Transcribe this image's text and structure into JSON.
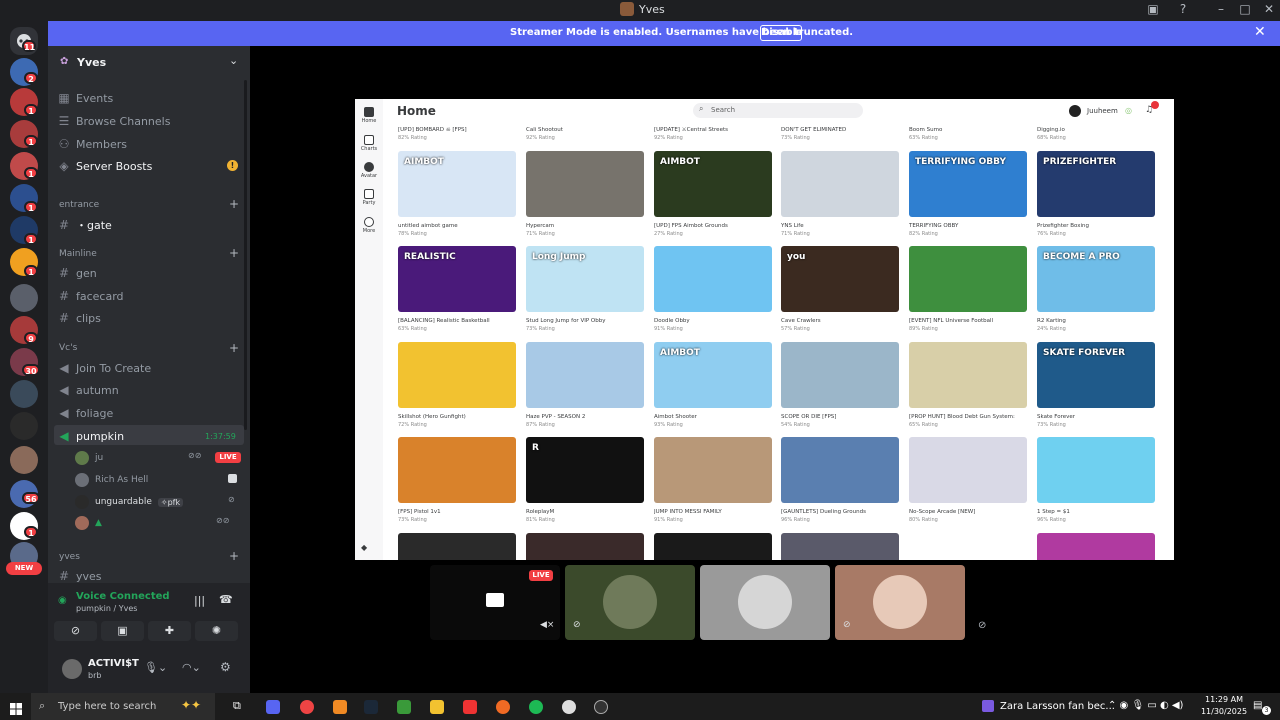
{
  "window": {
    "title": "Yves"
  },
  "banner": {
    "text": "Streamer Mode is enabled. Usernames have been truncated.",
    "disable_label": "Disable"
  },
  "rail": {
    "badges": [
      "11",
      "2",
      "1",
      "1",
      "1",
      "1",
      "1",
      "1",
      "1",
      "9",
      "30",
      "56",
      "1"
    ],
    "new_label": "NEW"
  },
  "server": {
    "name": "Yves"
  },
  "sidebar": {
    "top_items": [
      "Events",
      "Browse Channels",
      "Members",
      "Server Boosts"
    ],
    "categories": {
      "entrance": "entrance",
      "mainline": "Mainline",
      "vcs": "Vc's",
      "yves": "yves"
    },
    "channels": {
      "gate": "・gate",
      "gen": "gen",
      "facecard": "facecard",
      "clips": "clips",
      "join": "Join To Create",
      "autumn": "autumn",
      "foliage": "foliage",
      "pumpkin": "pumpkin",
      "pumpkin_time": "1:37:59",
      "yves": "yves"
    },
    "voice_users": [
      "ju",
      "Rich As Hell",
      "unguardable",
      "✧pfk",
      ""
    ],
    "live_label": "LIVE"
  },
  "voice": {
    "status": "Voice Connected",
    "channel": "pumpkin / Yves"
  },
  "user": {
    "name": "ACTIVI$T",
    "status": "brb"
  },
  "roblox": {
    "page_title": "Home",
    "search_placeholder": "Search",
    "username": "Juuheem",
    "nav": [
      "Home",
      "Charts",
      "Avatar",
      "Party",
      "More"
    ],
    "top_row": [
      {
        "name": "[UPD] BOMBARD ☠ [FPS]",
        "rating": "82% Rating"
      },
      {
        "name": "Cali Shootout",
        "rating": "92% Rating"
      },
      {
        "name": "[UPDATE] ⚔Central Streets",
        "rating": "92% Rating"
      },
      {
        "name": "DON'T GET ELIMINATED",
        "rating": "73% Rating"
      },
      {
        "name": "Boom Sumo",
        "rating": "63% Rating"
      },
      {
        "name": "Digging.io",
        "rating": "68% Rating"
      }
    ],
    "rows": [
      [
        {
          "name": "untitled aimbot game",
          "rating": "78% Rating",
          "color": "#d8e6f5",
          "label": "AIMBOT"
        },
        {
          "name": "Hypercam",
          "rating": "71% Rating",
          "color": "#77736c",
          "label": ""
        },
        {
          "name": "[UPD] FPS Aimbot Grounds",
          "rating": "27% Rating",
          "color": "#2b3b1f",
          "label": "AIMBOT"
        },
        {
          "name": "YNS Life",
          "rating": "71% Rating",
          "color": "#cfd6de",
          "label": ""
        },
        {
          "name": "TERRIFYING OBBY",
          "rating": "82% Rating",
          "color": "#2f7fd0",
          "label": "TERRIFYING OBBY"
        },
        {
          "name": "Prizefighter Boxing",
          "rating": "76% Rating",
          "color": "#243b6e",
          "label": "PRIZEFIGHTER"
        }
      ],
      [
        {
          "name": "[BALANCING] Realistic Basketball",
          "rating": "63% Rating",
          "color": "#4a1a7a",
          "label": "REALISTIC"
        },
        {
          "name": "Stud Long Jump for VIP Obby",
          "rating": "73% Rating",
          "color": "#bfe3f3",
          "label": "Long Jump"
        },
        {
          "name": "Doodle Obby",
          "rating": "91% Rating",
          "color": "#6fc4f2",
          "label": ""
        },
        {
          "name": "Cave Crawlers",
          "rating": "57% Rating",
          "color": "#3b2a20",
          "label": "you"
        },
        {
          "name": "[EVENT] NFL Universe Football",
          "rating": "89% Rating",
          "color": "#3e8f3e",
          "label": ""
        },
        {
          "name": "R2 Karting",
          "rating": "24% Rating",
          "color": "#6fbde8",
          "label": "BECOME A PRO"
        }
      ],
      [
        {
          "name": "Skillshot (Hero Gunfight)",
          "rating": "72% Rating",
          "color": "#f2c230",
          "label": ""
        },
        {
          "name": "Haze PVP - SEASON 2",
          "rating": "87% Rating",
          "color": "#a8c9e6",
          "label": ""
        },
        {
          "name": "Aimbot Shooter",
          "rating": "93% Rating",
          "color": "#8fcdf0",
          "label": "AIMBOT"
        },
        {
          "name": "SCOPE OR DIE [FPS]",
          "rating": "54% Rating",
          "color": "#9bb6c9",
          "label": ""
        },
        {
          "name": "[PROP HUNT] Blood Debt Gun System:",
          "rating": "65% Rating",
          "color": "#d8cfa8",
          "label": ""
        },
        {
          "name": "Skate Forever",
          "rating": "73% Rating",
          "color": "#1f5a8a",
          "label": "SKATE FOREVER"
        }
      ],
      [
        {
          "name": "[FPS] Pistol 1v1",
          "rating": "73% Rating",
          "color": "#d9822b",
          "label": ""
        },
        {
          "name": "RoleplayM",
          "rating": "81% Rating",
          "color": "#111111",
          "label": "R"
        },
        {
          "name": "JUMP INTO MESSI FAMILY",
          "rating": "91% Rating",
          "color": "#b89878",
          "label": ""
        },
        {
          "name": "[GAUNTLETS] Dueling Grounds",
          "rating": "96% Rating",
          "color": "#5a7fb0",
          "label": ""
        },
        {
          "name": "No-Scope Arcade [NEW]",
          "rating": "80% Rating",
          "color": "#d9d9e6",
          "label": ""
        },
        {
          "name": "1 Step = $1",
          "rating": "96% Rating",
          "color": "#6fd0f0",
          "label": ""
        }
      ]
    ]
  },
  "video": {
    "live_label": "LIVE"
  },
  "taskbar": {
    "search_placeholder": "Type here to search",
    "media": "Zara Larsson fan bec...",
    "time": "11:29 AM",
    "date": "11/30/2025",
    "notif": "3"
  }
}
